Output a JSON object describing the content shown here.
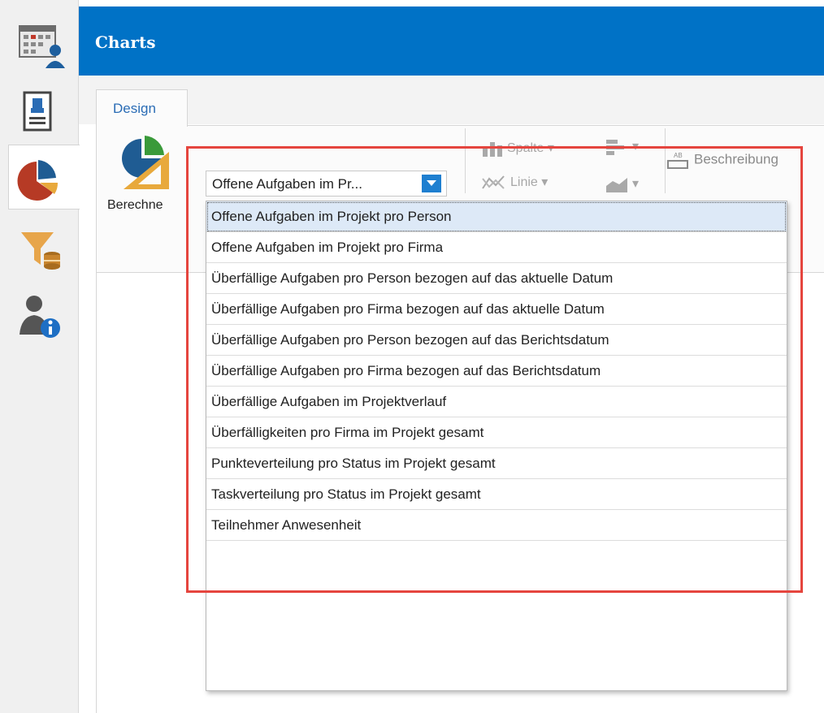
{
  "rail": {
    "items": [
      {
        "icon": "calendar-person-icon"
      },
      {
        "icon": "contact-card-icon"
      },
      {
        "icon": "pie-chart-icon",
        "active": true
      },
      {
        "icon": "filter-database-icon"
      },
      {
        "icon": "person-info-icon"
      }
    ]
  },
  "header": {
    "title": "Charts"
  },
  "ribbon": {
    "tab": "Design",
    "calculate_label": "Berechne",
    "column_label": "Spalte",
    "line_label": "Linie",
    "description_label": "Beschreibung"
  },
  "combo": {
    "value": "Offene Aufgaben im Pr..."
  },
  "dropdown": {
    "items": [
      "Offene Aufgaben im Projekt pro Person",
      "Offene Aufgaben im Projekt pro Firma",
      "Überfällige Aufgaben pro Person bezogen auf das aktuelle Datum",
      "Überfällige Aufgaben pro Firma bezogen auf das aktuelle Datum",
      "Überfällige Aufgaben pro Person bezogen auf das Berichtsdatum",
      "Überfällige Aufgaben pro Firma bezogen auf das Berichtsdatum",
      "Überfällige Aufgaben im Projektverlauf",
      "Überfälligkeiten pro Firma im Projekt gesamt",
      "Punkteverteilung pro Status im Projekt gesamt",
      "Taskverteilung pro Status im Projekt gesamt",
      "Teilnehmer Anwesenheit"
    ],
    "selected_index": 0
  },
  "colors": {
    "accent": "#0072c6",
    "highlight": "#e5453e",
    "selection": "#dde9f7"
  }
}
